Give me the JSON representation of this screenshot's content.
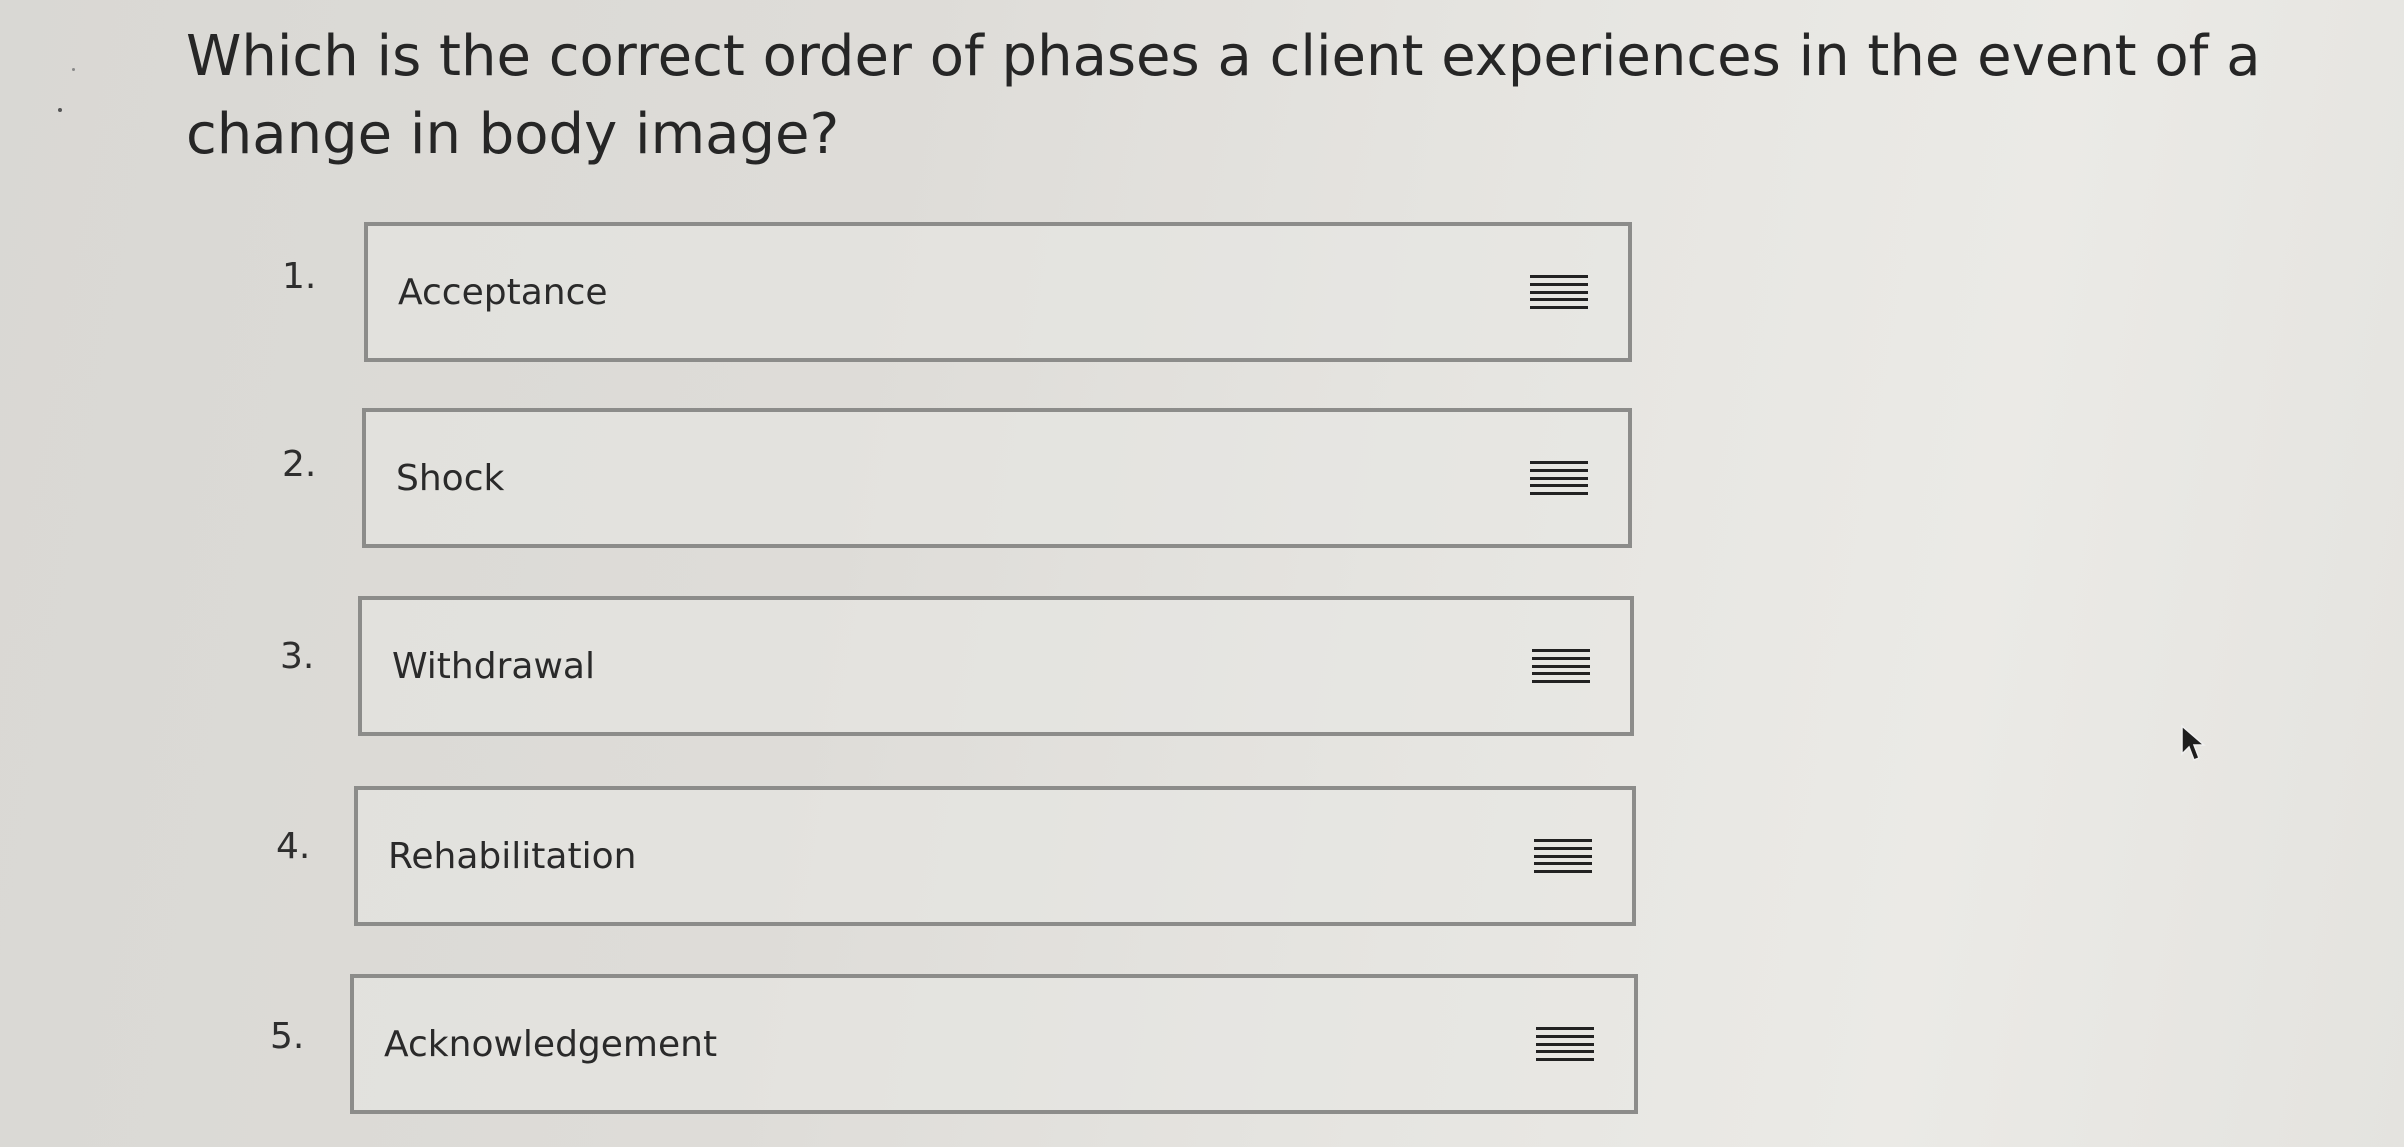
{
  "question": {
    "text": "Which is the correct order of phases a client experiences in the event of a change in body image?"
  },
  "ordering_items": [
    {
      "number": "1.",
      "label": "Acceptance"
    },
    {
      "number": "2.",
      "label": "Shock"
    },
    {
      "number": "3.",
      "label": "Withdrawal"
    },
    {
      "number": "4.",
      "label": "Rehabilitation"
    },
    {
      "number": "5.",
      "label": "Acknowledgement"
    }
  ],
  "icons": {
    "drag_handle": "drag-handle-icon",
    "cursor": "mouse-pointer-icon"
  },
  "colors": {
    "background": "#e0dfdb",
    "box_border": "#8c8c8a",
    "text": "#2a2a2a"
  }
}
